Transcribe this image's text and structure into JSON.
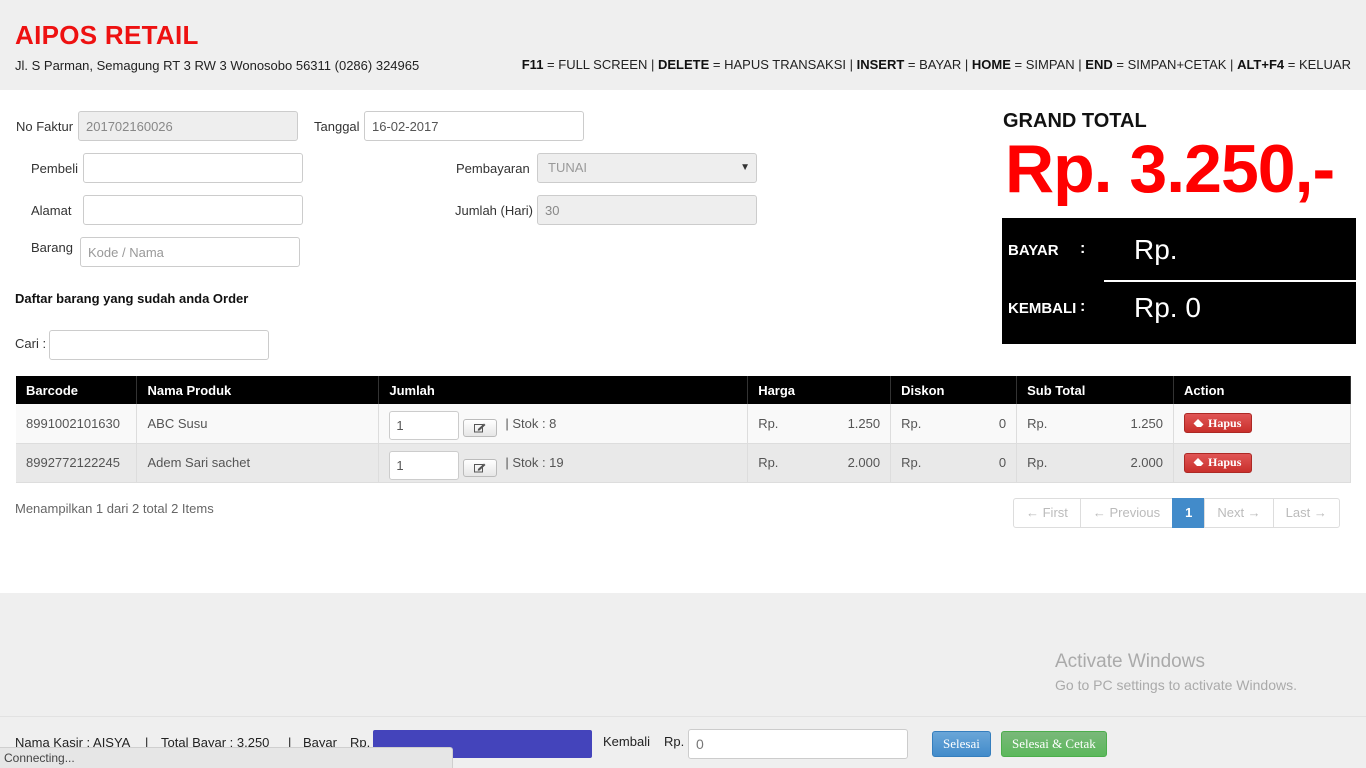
{
  "header": {
    "brand": "AIPOS RETAIL",
    "address": "Jl. S Parman, Semagung RT 3 RW 3 Wonosobo 56311 (0286) 324965",
    "shortcuts": [
      {
        "key": "F11",
        "action": "= FULL SCREEN"
      },
      {
        "key": "DELETE",
        "action": "= HAPUS TRANSAKSI"
      },
      {
        "key": "INSERT",
        "action": "= BAYAR"
      },
      {
        "key": "HOME",
        "action": "= SIMPAN"
      },
      {
        "key": "END",
        "action": "= SIMPAN+CETAK"
      },
      {
        "key": "ALT+F4",
        "action": "= KELUAR"
      }
    ],
    "separator": "|"
  },
  "form": {
    "no_faktur_label": "No Faktur",
    "no_faktur_value": "201702160026",
    "tanggal_label": "Tanggal",
    "tanggal_value": "16-02-2017",
    "pembeli_label": "Pembeli",
    "pembeli_value": "",
    "pembayaran_label": "Pembayaran",
    "pembayaran_value": "TUNAI",
    "alamat_label": "Alamat",
    "alamat_value": "",
    "jumlah_hari_label": "Jumlah (Hari)",
    "jumlah_hari_value": "30",
    "barang_label": "Barang",
    "barang_placeholder": "Kode / Nama"
  },
  "order": {
    "title": "Daftar barang yang sudah anda Order",
    "cari_label": "Cari :",
    "cari_value": ""
  },
  "summary": {
    "grand_total_label": "GRAND TOTAL",
    "grand_total_value": "Rp. 3.250,-",
    "bayar_label": "BAYAR",
    "bayar_value": "Rp.",
    "kembali_label": "KEMBALI",
    "kembali_value": "Rp. 0",
    "colon": ":"
  },
  "table": {
    "headers": [
      "Barcode",
      "Nama Produk",
      "Jumlah",
      "Harga",
      "Diskon",
      "Sub Total",
      "Action"
    ],
    "rows": [
      {
        "barcode": "8991002101630",
        "nama": "ABC Susu",
        "qty": "1",
        "stok": "| Stok : 8",
        "harga_cur": "Rp.",
        "harga": "1.250",
        "diskon_cur": "Rp.",
        "diskon": "0",
        "sub_cur": "Rp.",
        "subtotal": "1.250",
        "action": "Hapus"
      },
      {
        "barcode": "8992772122245",
        "nama": "Adem Sari sachet",
        "qty": "1",
        "stok": "| Stok : 19",
        "harga_cur": "Rp.",
        "harga": "2.000",
        "diskon_cur": "Rp.",
        "diskon": "0",
        "sub_cur": "Rp.",
        "subtotal": "2.000",
        "action": "Hapus"
      }
    ]
  },
  "pagination": {
    "info": "Menampilkan 1 dari 2 total 2 Items",
    "first": "← First",
    "previous": "← Previous",
    "current": "1",
    "next": "Next →",
    "last": "Last →"
  },
  "watermark": {
    "line1": "Activate Windows",
    "line2": "Go to PC settings to activate Windows."
  },
  "footer": {
    "kasir": "Nama Kasir : AISYA",
    "sep": "|",
    "total_bayar": "Total Bayar : 3.250",
    "bayar_label": "Bayar",
    "rp1": "Rp.",
    "kembali_label": "Kembali",
    "rp2": "Rp.",
    "kembali_value": "0",
    "selesai": "Selesai",
    "selesai_cetak": "Selesai & Cetak"
  },
  "status_bar": {
    "text": "Connecting..."
  },
  "colors": {
    "brand_red": "#ee1111",
    "grand_total_red": "#ff0000",
    "bayar_bar": "#4444bb",
    "active_page": "#428bca"
  }
}
